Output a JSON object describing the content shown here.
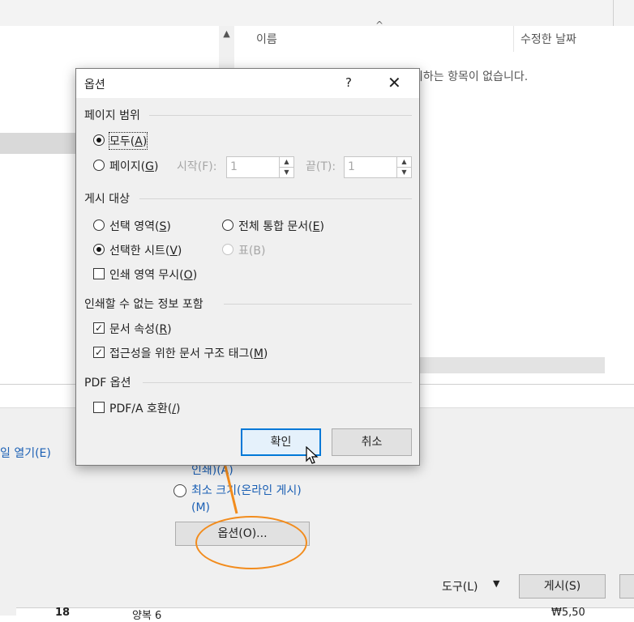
{
  "background": {
    "columns": {
      "name": "이름",
      "date": "수정한 날짜"
    },
    "empty_message": "치하는 항목이 없습니다.",
    "open_file_link": "일 열기(E)",
    "print_link": "인쇄)(A)",
    "min_size_option": "최소 크기(온라인 게시)(M)",
    "options_button": "옵션(O)...",
    "tools_label": "도구(L)",
    "publish_button": "게시(S)",
    "table_row": {
      "number": "18",
      "name": "양복 6",
      "price": "₩5,50"
    }
  },
  "dialog": {
    "title": "옵션",
    "help": "?",
    "close": "✕",
    "page_range": {
      "heading": "페이지 범위",
      "all_label": "모두(",
      "all_key": "A",
      "pages_label": "페이지(",
      "pages_key": "G",
      "start_label": "시작(F):",
      "start_value": "1",
      "end_label": "끝(T):",
      "end_value": "1",
      "selected": "all"
    },
    "publish_target": {
      "heading": "게시 대상",
      "selection_label": "선택 영역(",
      "selection_key": "S",
      "entire_label": "전체 통합 문서(",
      "entire_key": "E",
      "sheets_label": "선택한 시트(",
      "sheets_key": "V",
      "table_label": "표(B)",
      "ignore_print_label": "인쇄 영역 무시(",
      "ignore_print_key": "O",
      "selected": "sheets",
      "ignore_print_checked": false
    },
    "nonprint_info": {
      "heading": "인쇄할 수 없는 정보 포함",
      "doc_props_label": "문서 속성(",
      "doc_props_key": "R",
      "doc_props_checked": true,
      "accessibility_label": "접근성을 위한 문서 구조 태그(",
      "accessibility_key": "M",
      "accessibility_checked": true
    },
    "pdf_options": {
      "heading": "PDF 옵션",
      "pdfa_label": "PDF/A 호환(",
      "pdfa_key": "/",
      "pdfa_checked": false
    },
    "ok_button": "확인",
    "cancel_button": "취소"
  },
  "colors": {
    "accent": "#0078d7",
    "annotation": "#f28c1d",
    "link": "#1a5fb4"
  }
}
